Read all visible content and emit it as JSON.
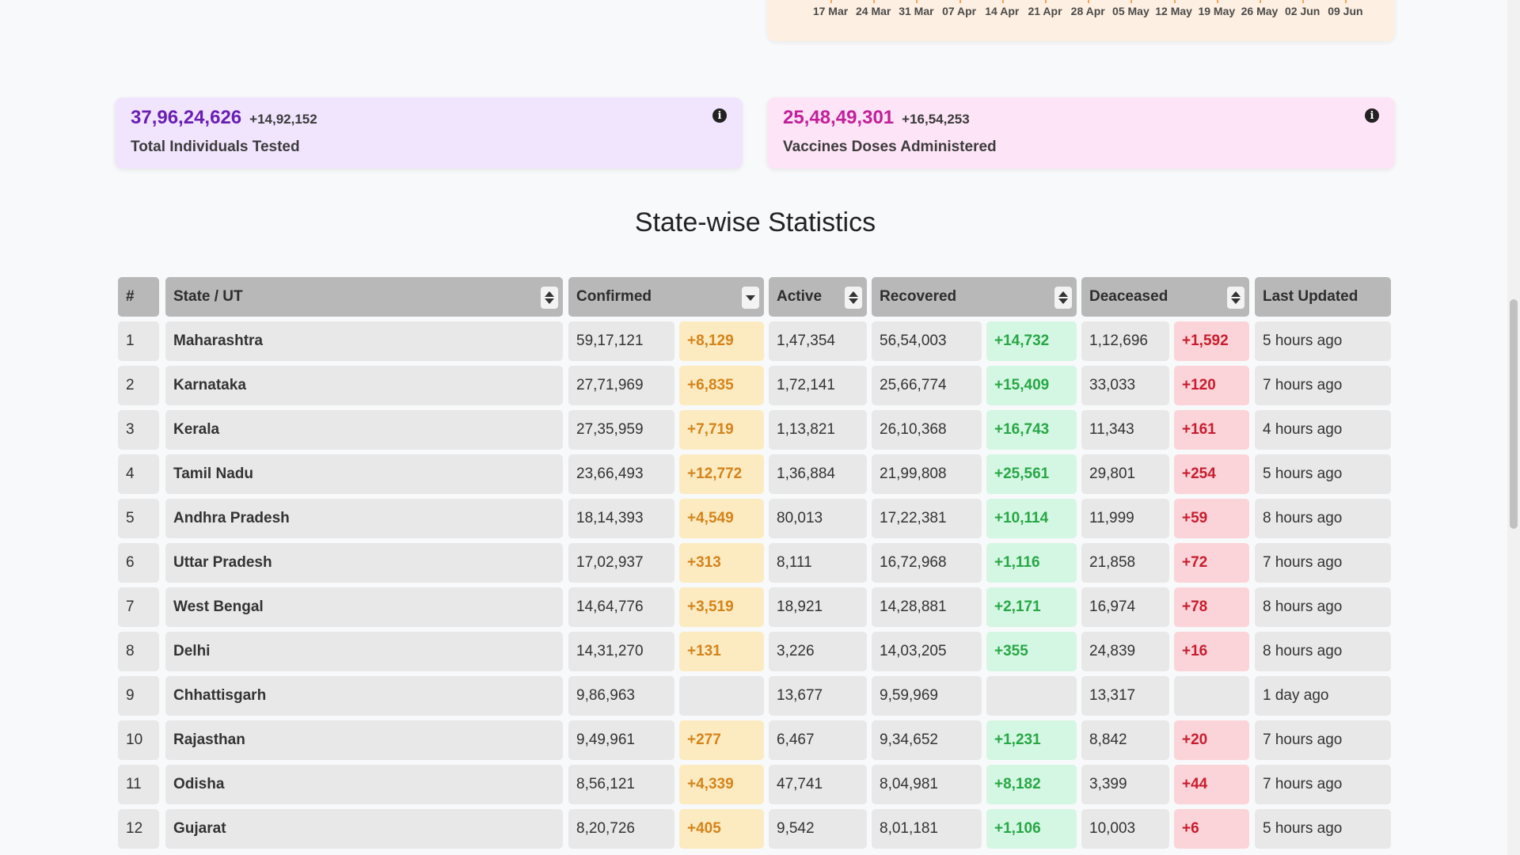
{
  "chart": {
    "labels": [
      "17 Mar",
      "24 Mar",
      "31 Mar",
      "07 Apr",
      "14 Apr",
      "21 Apr",
      "28 Apr",
      "05 May",
      "12 May",
      "19 May",
      "26 May",
      "02 Jun",
      "09 Jun"
    ]
  },
  "tested": {
    "value": "37,96,24,626",
    "delta": "+14,92,152",
    "label": "Total Individuals Tested"
  },
  "vaccine": {
    "value": "25,48,49,301",
    "delta": "+16,54,253",
    "label": "Vaccines Doses Administered"
  },
  "section_title": "State-wise Statistics",
  "headers": {
    "num": "#",
    "state": "State / UT",
    "confirmed": "Confirmed",
    "active": "Active",
    "recovered": "Recovered",
    "deceased": "Deaceased",
    "updated": "Last Updated"
  },
  "rows": [
    {
      "n": "1",
      "state": "Maharashtra",
      "conf": "59,17,121",
      "dconf": "+8,129",
      "active": "1,47,354",
      "rec": "56,54,003",
      "drec": "+14,732",
      "dec": "1,12,696",
      "ddec": "+1,592",
      "upd": "5 hours ago"
    },
    {
      "n": "2",
      "state": "Karnataka",
      "conf": "27,71,969",
      "dconf": "+6,835",
      "active": "1,72,141",
      "rec": "25,66,774",
      "drec": "+15,409",
      "dec": "33,033",
      "ddec": "+120",
      "upd": "7 hours ago"
    },
    {
      "n": "3",
      "state": "Kerala",
      "conf": "27,35,959",
      "dconf": "+7,719",
      "active": "1,13,821",
      "rec": "26,10,368",
      "drec": "+16,743",
      "dec": "11,343",
      "ddec": "+161",
      "upd": "4 hours ago"
    },
    {
      "n": "4",
      "state": "Tamil Nadu",
      "conf": "23,66,493",
      "dconf": "+12,772",
      "active": "1,36,884",
      "rec": "21,99,808",
      "drec": "+25,561",
      "dec": "29,801",
      "ddec": "+254",
      "upd": "5 hours ago"
    },
    {
      "n": "5",
      "state": "Andhra Pradesh",
      "conf": "18,14,393",
      "dconf": "+4,549",
      "active": "80,013",
      "rec": "17,22,381",
      "drec": "+10,114",
      "dec": "11,999",
      "ddec": "+59",
      "upd": "8 hours ago"
    },
    {
      "n": "6",
      "state": "Uttar Pradesh",
      "conf": "17,02,937",
      "dconf": "+313",
      "active": "8,111",
      "rec": "16,72,968",
      "drec": "+1,116",
      "dec": "21,858",
      "ddec": "+72",
      "upd": "7 hours ago"
    },
    {
      "n": "7",
      "state": "West Bengal",
      "conf": "14,64,776",
      "dconf": "+3,519",
      "active": "18,921",
      "rec": "14,28,881",
      "drec": "+2,171",
      "dec": "16,974",
      "ddec": "+78",
      "upd": "8 hours ago"
    },
    {
      "n": "8",
      "state": "Delhi",
      "conf": "14,31,270",
      "dconf": "+131",
      "active": "3,226",
      "rec": "14,03,205",
      "drec": "+355",
      "dec": "24,839",
      "ddec": "+16",
      "upd": "8 hours ago"
    },
    {
      "n": "9",
      "state": "Chhattisgarh",
      "conf": "9,86,963",
      "dconf": "",
      "active": "13,677",
      "rec": "9,59,969",
      "drec": "",
      "dec": "13,317",
      "ddec": "",
      "upd": "1 day ago"
    },
    {
      "n": "10",
      "state": "Rajasthan",
      "conf": "9,49,961",
      "dconf": "+277",
      "active": "6,467",
      "rec": "9,34,652",
      "drec": "+1,231",
      "dec": "8,842",
      "ddec": "+20",
      "upd": "7 hours ago"
    },
    {
      "n": "11",
      "state": "Odisha",
      "conf": "8,56,121",
      "dconf": "+4,339",
      "active": "47,741",
      "rec": "8,04,981",
      "drec": "+8,182",
      "dec": "3,399",
      "ddec": "+44",
      "upd": "7 hours ago"
    },
    {
      "n": "12",
      "state": "Gujarat",
      "conf": "8,20,726",
      "dconf": "+405",
      "active": "9,542",
      "rec": "8,01,181",
      "drec": "+1,106",
      "dec": "10,003",
      "ddec": "+6",
      "upd": "5 hours ago"
    }
  ]
}
